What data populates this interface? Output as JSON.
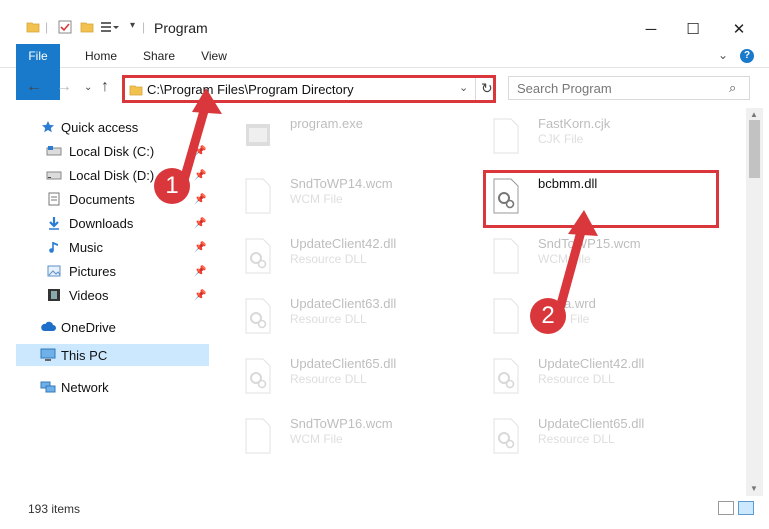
{
  "window": {
    "title": "Program"
  },
  "ribbon": {
    "file": "File",
    "home": "Home",
    "share": "Share",
    "view": "View",
    "help_glyph": "?"
  },
  "address": {
    "path": "C:\\Program Files\\Program Directory",
    "search_placeholder": "Search Program"
  },
  "sidebar": {
    "items": [
      {
        "label": "Quick access",
        "icon": "star-icon"
      },
      {
        "label": "Local Disk (C:)",
        "icon": "drive-icon"
      },
      {
        "label": "Local Disk (D:)",
        "icon": "drive-icon"
      },
      {
        "label": "Documents",
        "icon": "documents-icon"
      },
      {
        "label": "Downloads",
        "icon": "download-icon"
      },
      {
        "label": "Music",
        "icon": "music-icon"
      },
      {
        "label": "Pictures",
        "icon": "pictures-icon"
      },
      {
        "label": "Videos",
        "icon": "videos-icon"
      },
      {
        "label": "OneDrive",
        "icon": "cloud-icon"
      },
      {
        "label": "This PC",
        "icon": "computer-icon"
      },
      {
        "label": "Network",
        "icon": "network-icon"
      }
    ]
  },
  "files": [
    {
      "name": "program.exe",
      "type": ""
    },
    {
      "name": "FastKorn.cjk",
      "type": "CJK File"
    },
    {
      "name": "SndToWP14.wcm",
      "type": "WCM File"
    },
    {
      "name": "bcbmm.dll",
      "type": ""
    },
    {
      "name": "UpdateClient42.dll",
      "type": "Resource DLL"
    },
    {
      "name": "SndToWP15.wcm",
      "type": "WCM File"
    },
    {
      "name": "UpdateClient63.dll",
      "type": "Resource DLL"
    },
    {
      "name": "Aralia.wrd",
      "type": "WRD File"
    },
    {
      "name": "UpdateClient65.dll",
      "type": "Resource DLL"
    },
    {
      "name": "UpdateClient42.dll",
      "type": "Resource DLL"
    },
    {
      "name": "SndToWP16.wcm",
      "type": "WCM File"
    },
    {
      "name": "UpdateClient65.dll",
      "type": "Resource DLL"
    }
  ],
  "status": {
    "count": "193 items"
  },
  "annotations": {
    "step1": "1",
    "step2": "2"
  },
  "colors": {
    "accent": "#1979ca",
    "highlight": "#d9373b",
    "selected": "#cce8ff"
  }
}
